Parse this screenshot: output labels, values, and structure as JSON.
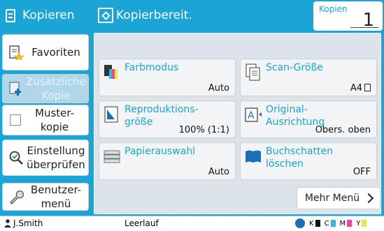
{
  "header": {
    "app_title": "Kopieren",
    "status": "Kopierbereit.",
    "copies_label": "Kopien",
    "copies_value": "1"
  },
  "sidebar": [
    {
      "label": "Favoriten"
    },
    {
      "label": "Zusätzliche Kopie"
    },
    {
      "label": "Muster-kopie"
    },
    {
      "label": "Einstellung überprüfen"
    },
    {
      "label": "Benutzer-menü"
    }
  ],
  "tiles": [
    {
      "label": "Farbmodus",
      "value": "Auto",
      "icon": "color-mode-icon"
    },
    {
      "label": "Scan-Größe",
      "value": "A4",
      "icon": "scan-size-icon"
    },
    {
      "label": "Reproduktions-größe",
      "value": "100% (1:1)",
      "icon": "reproduction-size-icon"
    },
    {
      "label": "Original-Ausrichtung",
      "value": "Obers. oben",
      "icon": "original-orientation-icon"
    },
    {
      "label": "Papierauswahl",
      "value": "Auto",
      "icon": "paper-select-icon"
    },
    {
      "label": "Buchschatten löschen",
      "value": "OFF",
      "icon": "book-shadow-icon"
    }
  ],
  "more_button": "Mehr Menü",
  "footer": {
    "user": "J.Smith",
    "status": "Leerlauf",
    "toner": [
      "K",
      "C",
      "M",
      "Y"
    ]
  },
  "colors": {
    "accent": "#1aa5d6",
    "k": "#111111",
    "c": "#2fb7e8",
    "m": "#e8459b",
    "y": "#f3e33a"
  }
}
